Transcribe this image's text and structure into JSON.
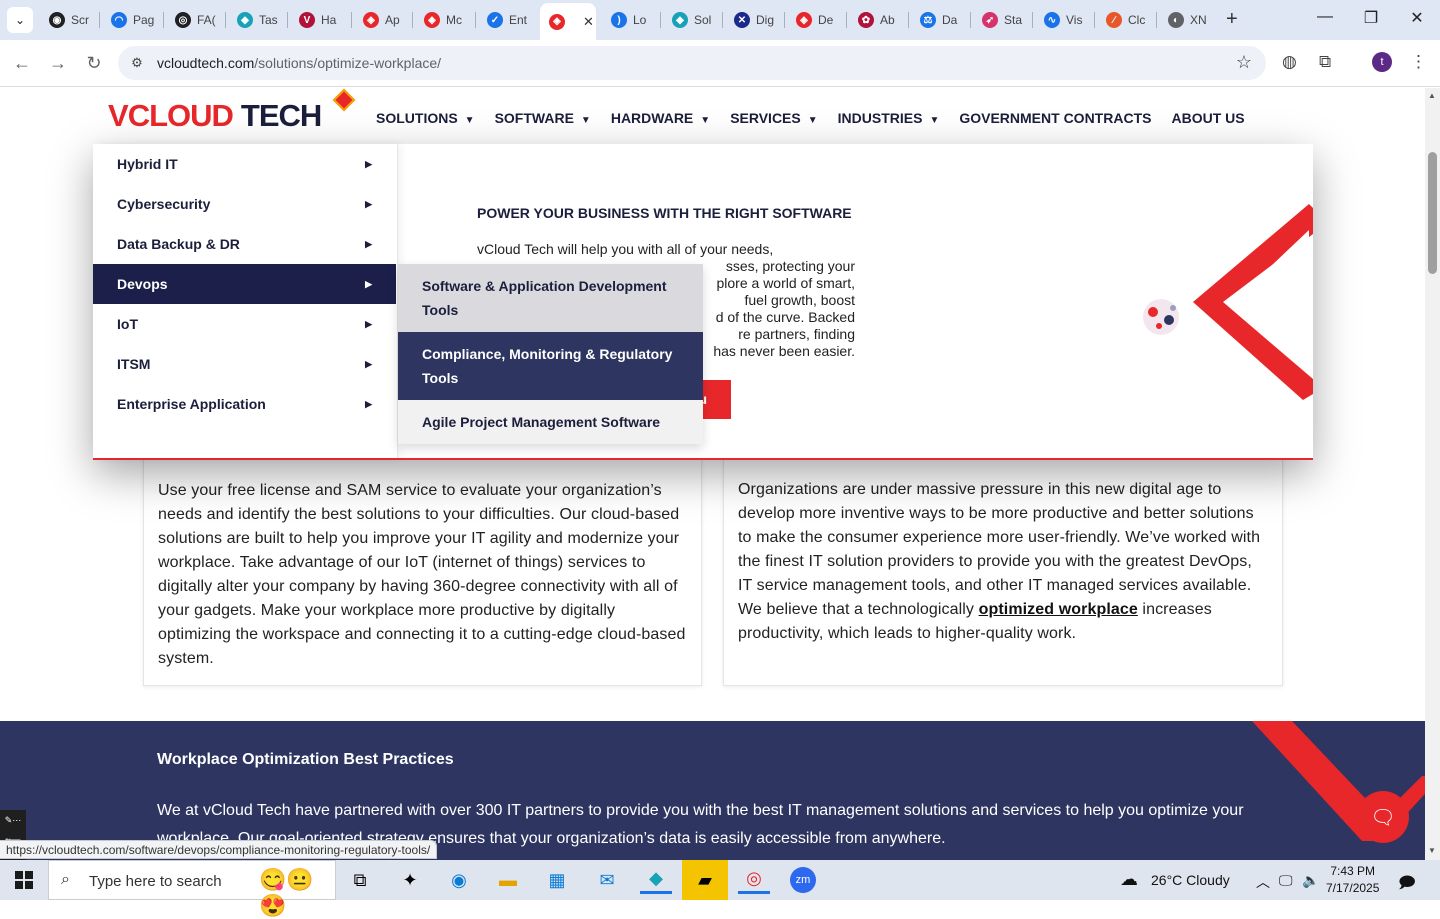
{
  "browser": {
    "tabs": [
      {
        "title": "Scr",
        "color": "#202124",
        "glyph": "◉"
      },
      {
        "title": "Pag",
        "color": "#1a73e8",
        "glyph": "◠"
      },
      {
        "title": "FA(",
        "color": "#202124",
        "glyph": "◎"
      },
      {
        "title": "Tas",
        "color": "#17a2b8",
        "glyph": "◆"
      },
      {
        "title": "Ha",
        "color": "#b0123a",
        "glyph": "V"
      },
      {
        "title": "Ap",
        "color": "#e8272a",
        "glyph": "◈"
      },
      {
        "title": "Mc",
        "color": "#e8272a",
        "glyph": "◈"
      },
      {
        "title": "Ent",
        "color": "#1a73e8",
        "glyph": "✓"
      },
      {
        "title": "",
        "color": "#e8272a",
        "glyph": "◈",
        "active": true
      },
      {
        "title": "Lo",
        "color": "#1a73e8",
        "glyph": ")"
      },
      {
        "title": "Sol",
        "color": "#17a2b8",
        "glyph": "◆"
      },
      {
        "title": "Dig",
        "color": "#1b2a8a",
        "glyph": "✕"
      },
      {
        "title": "De",
        "color": "#e8272a",
        "glyph": "◈"
      },
      {
        "title": "Ab",
        "color": "#b0123a",
        "glyph": "✿"
      },
      {
        "title": "Da",
        "color": "#1a73e8",
        "glyph": "⚖"
      },
      {
        "title": "Sta",
        "color": "#d6336c",
        "glyph": "➶"
      },
      {
        "title": "Vis",
        "color": "#1a73e8",
        "glyph": "∿"
      },
      {
        "title": "Clc",
        "color": "#e8572a",
        "glyph": "∕"
      },
      {
        "title": "XN",
        "color": "#5f6368",
        "glyph": "◐"
      }
    ],
    "active_tab_close": "✕",
    "new_tab": "+",
    "url_domain": "vcloudtech.com",
    "url_path": "/solutions/optimize-workplace/",
    "status_url": "https://vcloudtech.com/software/devops/compliance-monitoring-regulatory-tools/",
    "profile_initial": "t"
  },
  "site": {
    "logo_v": "V",
    "logo_cloud": "CLOUD",
    "logo_tech": "TECH",
    "nav": [
      {
        "label": "SOLUTIONS",
        "caret": true
      },
      {
        "label": "SOFTWARE",
        "caret": true
      },
      {
        "label": "HARDWARE",
        "caret": true
      },
      {
        "label": "SERVICES",
        "caret": true
      },
      {
        "label": "INDUSTRIES",
        "caret": true
      },
      {
        "label": "GOVERNMENT CONTRACTS",
        "caret": false
      },
      {
        "label": "ABOUT US",
        "caret": false
      }
    ],
    "mega_categories": [
      "Hybrid IT",
      "Cybersecurity",
      "Data Backup & DR",
      "Devops",
      "IoT",
      "ITSM",
      "Enterprise Application"
    ],
    "active_category": 3,
    "submenu": [
      "Software & Application Development Tools",
      "Compliance, Monitoring & Regulatory Tools",
      "Agile Project Management Software"
    ],
    "mega_heading": "POWER YOUR BUSINESS WITH THE RIGHT SOFTWARE",
    "mega_para_lines": [
      "vCloud Tech will help you with all of your needs,",
      "sses, protecting your",
      "plore a world of smart,",
      "fuel growth, boost",
      "d of the curve. Backed",
      "re partners, finding",
      "has never been easier."
    ],
    "mega_btn_fragment": "u",
    "card_left_text": "Use your free license and SAM service to evaluate your organization’s needs and identify the best solutions to your difficulties. Our cloud-based solutions are built to help you improve your IT agility and modernize your workplace. Take advantage of our IoT (internet of things) services to digitally alter your company by having 360-degree connectivity with all of your gadgets. Make your workplace more productive by digitally optimizing the workspace and connecting it to a cutting-edge cloud-based system.",
    "card_right_before": "Organizations are under massive pressure in this new digital age to develop more inventive ways to be more productive and better solutions to make the consumer experience more user-friendly. We’ve worked with the finest IT solution providers to provide you with the greatest DevOps, IT service management tools, and other IT managed services available. We believe that a technologically ",
    "card_right_link": "optimized workplace",
    "card_right_after": " increases productivity, which leads to higher-quality work.",
    "band_title": "Workplace Optimization Best Practices",
    "band_text": "We at vCloud Tech have partnered with over 300 IT partners to provide you with the best IT management solutions and services to help you optimize your workplace. Our goal-oriented strategy ensures that your organization’s data is easily accessible from anywhere."
  },
  "taskbar": {
    "search_placeholder": "Type here to search",
    "weather": "26°C  Cloudy",
    "weather_badge": "1",
    "time": "7:43 PM",
    "date": "7/17/2025",
    "notif_count": "1"
  },
  "colors": {
    "brand_red": "#e8272a",
    "brand_navy": "#1b1f4a",
    "band": "#2d3560"
  }
}
